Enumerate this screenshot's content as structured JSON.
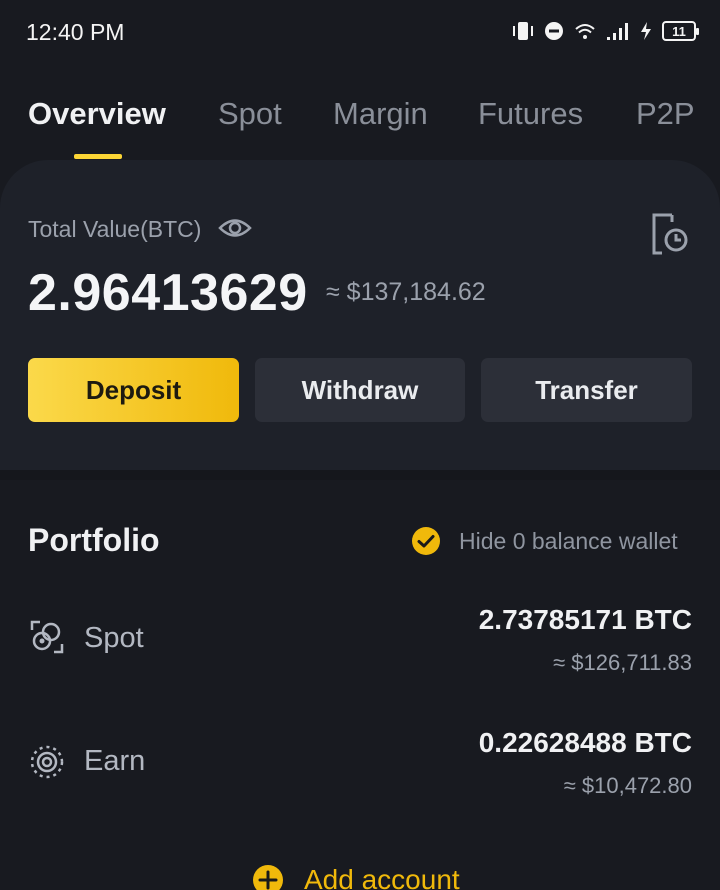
{
  "status_bar": {
    "time": "12:40 PM",
    "battery": "11",
    "icons": [
      "vibrate-icon",
      "do-not-disturb-icon",
      "wifi-icon",
      "signal-icon",
      "charging-icon",
      "battery-icon"
    ]
  },
  "tabs": [
    {
      "label": "Overview",
      "active": true
    },
    {
      "label": "Spot",
      "active": false
    },
    {
      "label": "Margin",
      "active": false
    },
    {
      "label": "Futures",
      "active": false
    },
    {
      "label": "P2P",
      "active": false
    }
  ],
  "balance": {
    "label": "Total Value(BTC)",
    "btc": "2.96413629",
    "usd": "≈ $137,184.62"
  },
  "actions": {
    "deposit": "Deposit",
    "withdraw": "Withdraw",
    "transfer": "Transfer"
  },
  "portfolio": {
    "title": "Portfolio",
    "hide_zero_label": "Hide 0 balance wallet",
    "hide_zero_checked": true,
    "accounts": [
      {
        "name": "Spot",
        "icon": "spot-wallet-icon",
        "btc": "2.73785171 BTC",
        "usd": "≈ $126,711.83"
      },
      {
        "name": "Earn",
        "icon": "earn-icon",
        "btc": "0.22628488 BTC",
        "usd": "≈ $10,472.80"
      }
    ],
    "add_account": "Add account"
  },
  "colors": {
    "background": "#181a20",
    "card": "#1e2129",
    "accent": "#f0b90b",
    "button_secondary": "#2c2f38",
    "muted_text": "#9ba1ac"
  }
}
